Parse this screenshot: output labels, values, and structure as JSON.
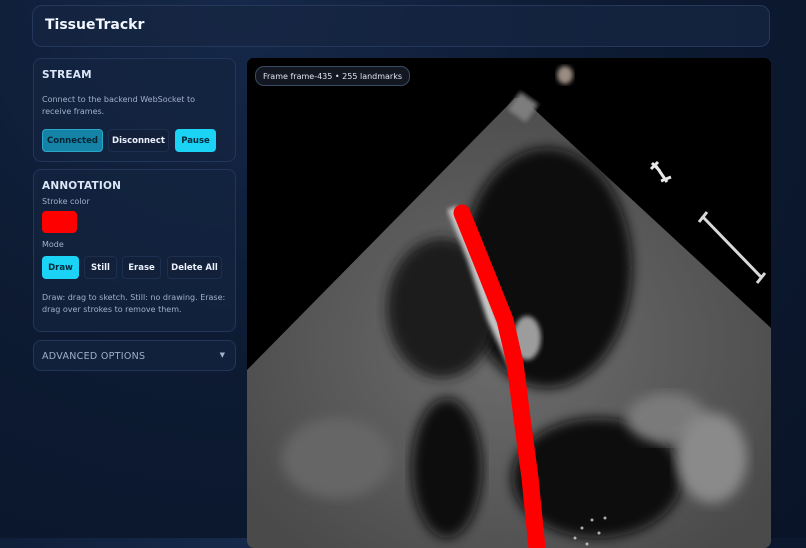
{
  "app": {
    "title": "TissueTrackr"
  },
  "stream": {
    "title": "STREAM",
    "description": "Connect to the backend WebSocket to receive frames.",
    "buttons": {
      "connected": "Connected",
      "disconnect": "Disconnect",
      "pause": "Pause"
    }
  },
  "annotation": {
    "title": "ANNOTATION",
    "stroke_color_label": "Stroke color",
    "stroke_color": "#ff0000",
    "mode_label": "Mode",
    "modes": {
      "draw": "Draw",
      "still": "Still",
      "erase": "Erase",
      "delete_all": "Delete All"
    },
    "active_mode": "Draw",
    "help": "Draw: drag to sketch. Still: no drawing. Erase: drag over strokes to remove them."
  },
  "advanced": {
    "label": "ADVANCED OPTIONS",
    "icon": "chevron-down-icon"
  },
  "viewer": {
    "frame_info": "Frame frame-435 • 255 landmarks"
  },
  "colors": {
    "accent": "#1ad3f5",
    "connected": "#1483a6",
    "stroke": "#ff0000",
    "background": "#0d1b33"
  }
}
